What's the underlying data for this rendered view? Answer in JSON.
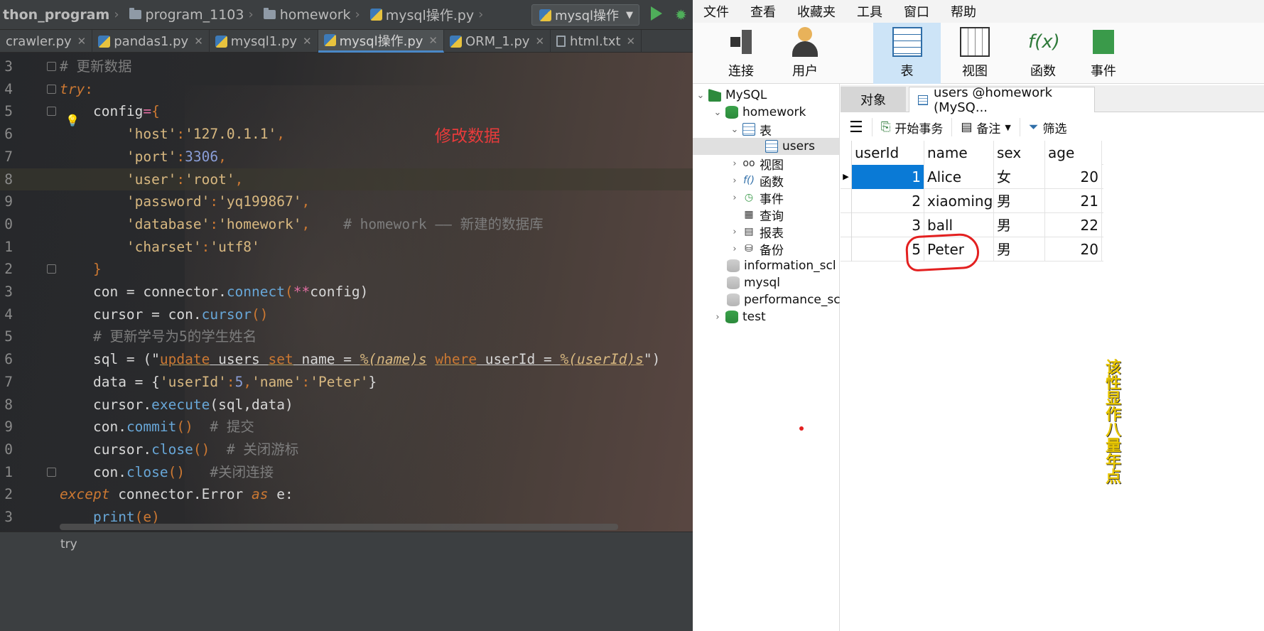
{
  "ide": {
    "breadcrumb": [
      "thon_program",
      "program_1103",
      "homework",
      "mysql操作.py"
    ],
    "run_config": "mysql操作",
    "tabs": [
      "crawler.py",
      "pandas1.py",
      "mysql1.py",
      "mysql操作.py",
      "ORM_1.py",
      "html.txt"
    ],
    "annotation": "修改数据",
    "status_breadcrumb": "try",
    "line_numbers": [
      "3",
      "4",
      "5",
      "6",
      "7",
      "8",
      "9",
      "0",
      "1",
      "2",
      "3",
      "4",
      "5",
      "6",
      "7",
      "8",
      "9",
      "0",
      "1",
      "2",
      "3"
    ],
    "code": {
      "l1": "# 更新数据",
      "l2_kw": "try",
      "l3": "config",
      "l4_k": "'host'",
      "l4_v": "'127.0.1.1'",
      "l5_k": "'port'",
      "l5_v": "3306",
      "l6_k": "'user'",
      "l6_v": "'root'",
      "l7_k": "'password'",
      "l7_v": "'yq199867'",
      "l8_k": "'database'",
      "l8_v": "'homework'",
      "l8_c": "# homework —— 新建的数据库",
      "l9_k": "'charset'",
      "l9_v": "'utf8'",
      "l10": "}",
      "l11_a": "con = connector.",
      "l11_fn": "connect",
      "l11_b": "(",
      "l11_op": "**",
      "l11_c": "config)",
      "l12_a": "cursor = con.",
      "l12_fn": "cursor",
      "l12_b": "()",
      "l13": "# 更新学号为5的学生姓名",
      "l14_a": "sql = (\"",
      "l14_k1": "update",
      "l14_t1": " users ",
      "l14_k2": "set",
      "l14_t2": " name = ",
      "l14_v1": "%(name)s",
      "l14_sp": " ",
      "l14_k3": "where",
      "l14_t3": " userId = ",
      "l14_v2": "%(userId)s",
      "l14_end": "\")",
      "l15_a": "data = {",
      "l15_k1": "'userId'",
      "l15_n": "5",
      "l15_k2": "'name'",
      "l15_v": "'Peter'",
      "l15_end": "}",
      "l16_a": "cursor.",
      "l16_fn": "execute",
      "l16_b": "(sql,data)",
      "l17_a": "con.",
      "l17_fn": "commit",
      "l17_b": "()",
      "l17_c": "# 提交",
      "l18_a": "cursor.",
      "l18_fn": "close",
      "l18_b": "()",
      "l18_c": "# 关闭游标",
      "l19_a": "con.",
      "l19_fn": "close",
      "l19_b": "()",
      "l19_c": "#关闭连接",
      "l20_kw": "except",
      "l20_a": " connector.Error ",
      "l20_as": "as",
      "l20_b": " e:",
      "l21_fn": "print",
      "l21_b": "(e)"
    }
  },
  "navicat": {
    "menus": [
      "文件",
      "查看",
      "收藏夹",
      "工具",
      "窗口",
      "帮助"
    ],
    "ribbon": [
      "连接",
      "用户",
      "表",
      "视图",
      "函数",
      "事件"
    ],
    "tree": {
      "root": "MySQL",
      "db": "homework",
      "tables_group": "表",
      "table": "users",
      "groups": [
        "视图",
        "函数",
        "事件",
        "查询",
        "报表",
        "备份"
      ],
      "other_dbs": [
        "information_scl",
        "mysql",
        "performance_sc",
        "test"
      ]
    },
    "object_tab": "对象",
    "table_tab": "users @homework (MySQ...",
    "toolbar": {
      "begin": "开始事务",
      "note": "备注",
      "filter": "筛选"
    },
    "grid": {
      "columns": [
        "userId",
        "name",
        "sex",
        "age"
      ],
      "rows": [
        [
          "1",
          "Alice",
          "女",
          "20"
        ],
        [
          "2",
          "xiaoming",
          "男",
          "21"
        ],
        [
          "3",
          "ball",
          "男",
          "22"
        ],
        [
          "5",
          "Peter",
          "男",
          "20"
        ]
      ]
    },
    "side_text": "该性显作八量年点"
  },
  "colors": {
    "keyword": "#cc7832",
    "string": "#d8b880",
    "number": "#8a9ed8",
    "annotation": "#e83b3b",
    "selection": "#0a7ad6"
  }
}
